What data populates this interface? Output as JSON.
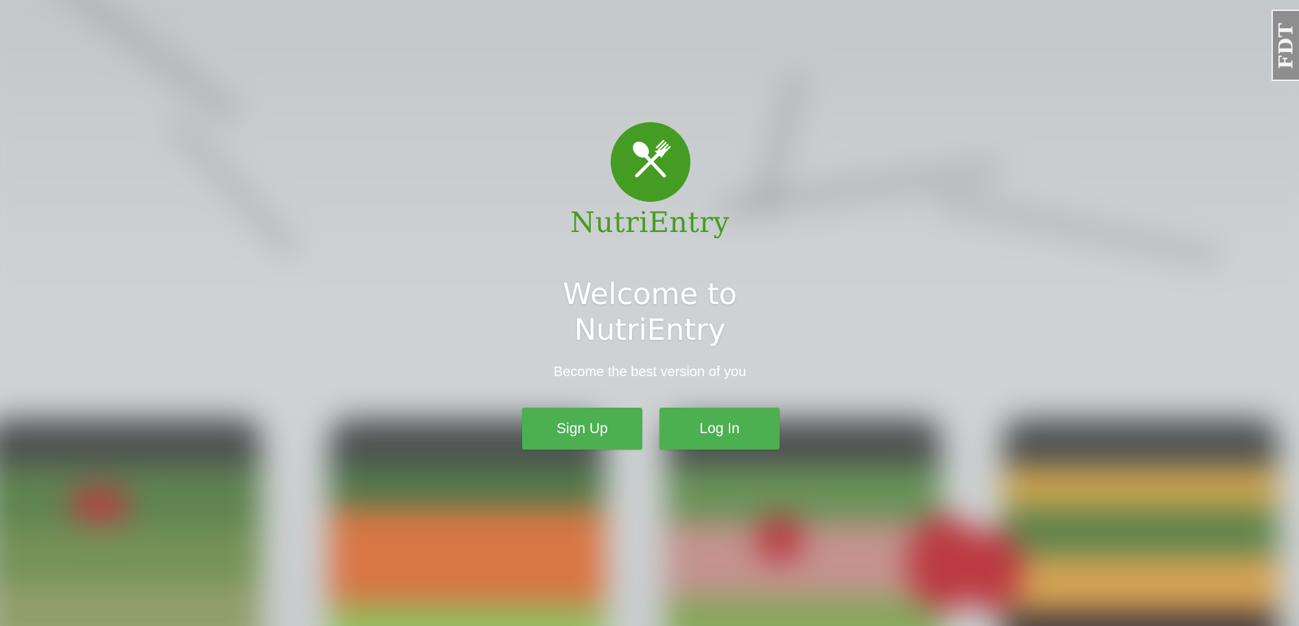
{
  "brand": {
    "name": "NutriEntry",
    "logo_icon": "spoon-fork-icon",
    "color": "#449d22"
  },
  "hero": {
    "welcome_line1": "Welcome to",
    "welcome_line2": "NutriEntry",
    "tagline": "Become the best version of you"
  },
  "actions": {
    "signup_label": "Sign Up",
    "login_label": "Log In",
    "button_color": "#4caf50"
  },
  "badge": {
    "label": "FDT"
  }
}
